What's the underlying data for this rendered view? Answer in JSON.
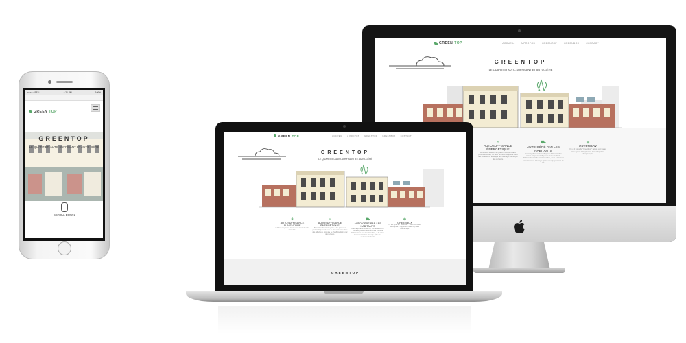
{
  "site": {
    "logo_text_a": "GREEN",
    "logo_text_b": "TOP",
    "menu": [
      "ACCUEIL",
      "A PROPOS",
      "GREENTOP",
      "GREENBOX",
      "CONTACT"
    ],
    "hero_title": "GREENTOP",
    "hero_subtitle": "LE QUARTIER AUTO-SUFFISANT ET AUTO-GÉRÉ",
    "features": [
      {
        "icon": "leaf-icon",
        "glyph": "⚘",
        "title": "AUTOSUFFISANCE ALIMENTAIRE",
        "desc": "Cultivez vos propres légumes sur le toit de votre immeuble."
      },
      {
        "icon": "link-icon",
        "glyph": "∞",
        "title": "AUTOSUFFISANCE ÉNERGÉTIQUE",
        "desc": "Bénéficiez d'électricité grâce à des panneaux photovoltaïques, de l'eau de pluie récupérée dans des collecteurs, ainsi que de chauffage fournis par des serveurs."
      },
      {
        "icon": "truck-icon",
        "glyph": "⛟",
        "title": "AUTO-GÉRÉ PAR LES HABITANTS",
        "desc": "Avec l'application GreenTop, les habitants d'un même îlot peuvent disposer d'une multitude d'informations et de fonctionnalités, et de suivre leur consommation d'énergie grâce aux équipements du toit."
      },
      {
        "icon": "greenbox-icon",
        "glyph": "⊕",
        "title": "GREENBOX",
        "desc": "Il y a 4 types de \"GreenBox\" : elles sont toutes liées grâce à l'application GreenTop dans chaque logis."
      }
    ],
    "footer_title": "GREENTOP",
    "scroll_label": "SCROLL DOWN"
  },
  "phone_status": {
    "carrier": "●●●●○ BELL",
    "time": "4:21 PM",
    "battery": "100%"
  },
  "colors": {
    "accent": "#5aa86b",
    "brick": "#b7715f",
    "cream": "#f3ecd3",
    "frame": "#151515"
  }
}
